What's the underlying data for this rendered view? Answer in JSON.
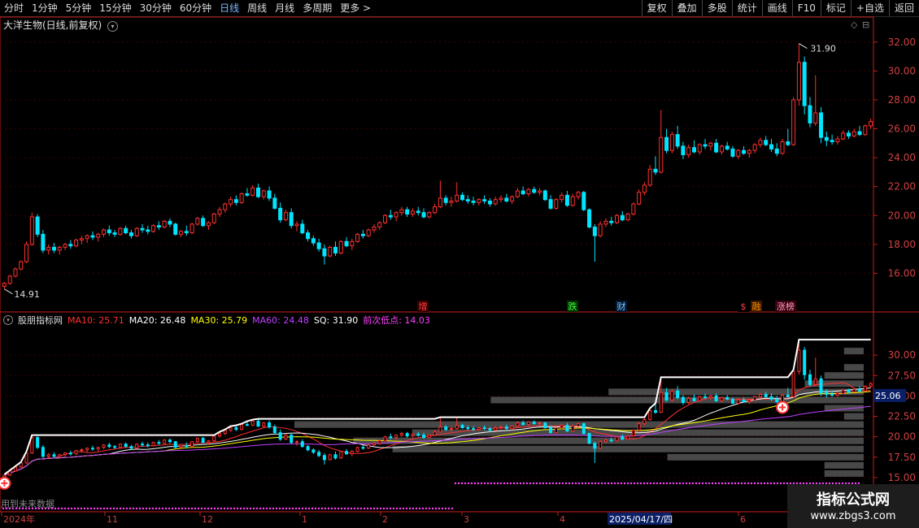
{
  "toolbar": {
    "periods": [
      "分时",
      "1分钟",
      "5分钟",
      "15分钟",
      "30分钟",
      "60分钟",
      "日线",
      "周线",
      "月线",
      "多周期",
      "更多 >"
    ],
    "active_period": "日线",
    "tools": [
      "复权",
      "叠加",
      "多股",
      "统计",
      "画线",
      "F10",
      "标记",
      "+自选",
      "返回"
    ]
  },
  "main_pane": {
    "title": "大洋生物(日线,前复权)",
    "high_label": "31.90",
    "low_label": "14.91",
    "events": [
      {
        "label": "增",
        "color": "#ff4040",
        "bg": "#3a0000"
      },
      {
        "label": "跌",
        "color": "#40ff40",
        "bg": "#003300"
      },
      {
        "label": "财",
        "color": "#7fbfff",
        "bg": "#001a33"
      },
      {
        "label": "$",
        "color": "#ff4040",
        "bg": "#000"
      },
      {
        "label": "融",
        "color": "#ff8c00",
        "bg": "#3a1a00"
      },
      {
        "label": "涨榜",
        "color": "#ff9ebb",
        "bg": "#3a0010"
      }
    ],
    "price_axis": [
      "32.00",
      "30.00",
      "28.00",
      "26.00",
      "24.00",
      "22.00",
      "20.00",
      "18.00",
      "16.00"
    ]
  },
  "indicator_pane": {
    "name": "股朋指标网",
    "legend": [
      {
        "label": "MA10: 25.71",
        "color": "#ff3030"
      },
      {
        "label": "MA20: 26.48",
        "color": "#ffffff"
      },
      {
        "label": "MA30: 25.79",
        "color": "#ffff00"
      },
      {
        "label": "MA60: 24.48",
        "color": "#c040ff"
      },
      {
        "label": "SQ: 31.90",
        "color": "#ffffff"
      },
      {
        "label": "前次低点: 14.03",
        "color": "#ff40ff"
      }
    ],
    "price_axis": [
      "30.00",
      "27.50",
      "25.00",
      "22.50",
      "20.00",
      "17.50",
      "15.00"
    ],
    "current_value": "25.06",
    "footer_note": "用到未来数据"
  },
  "time_axis": {
    "labels": [
      "2024年",
      "11",
      "12",
      "1",
      "2",
      "3",
      "4",
      "2025/04/17/四",
      "6"
    ],
    "cursor_date": "2025/04/17/四"
  },
  "watermark": {
    "line1": "指标公式网",
    "line2": "www.zbgs3.com"
  },
  "colors": {
    "up": "#ff3030",
    "down": "#00e5ff",
    "grid_red": "#8b0000",
    "axis_red": "#c81e1e"
  },
  "chart_data": {
    "type": "candlestick",
    "note_units": "CNY",
    "price_range_main": [
      14.0,
      33.0
    ],
    "price_range_indicator": [
      14.0,
      33.5
    ],
    "start_index_label": "2024年",
    "ohlc": [
      [
        15.1,
        15.4,
        14.91,
        15.3
      ],
      [
        15.3,
        15.9,
        15.2,
        15.8
      ],
      [
        15.8,
        16.4,
        15.7,
        16.3
      ],
      [
        16.3,
        16.9,
        16.2,
        16.8
      ],
      [
        16.8,
        18.2,
        16.7,
        18.0
      ],
      [
        18.0,
        20.2,
        17.9,
        19.9
      ],
      [
        19.9,
        20.1,
        18.5,
        18.7
      ],
      [
        18.7,
        19.0,
        17.4,
        17.6
      ],
      [
        17.6,
        18.0,
        17.3,
        17.8
      ],
      [
        17.8,
        18.1,
        17.4,
        17.6
      ],
      [
        17.6,
        17.9,
        17.3,
        17.8
      ],
      [
        17.8,
        18.1,
        17.6,
        18.0
      ],
      [
        18.0,
        18.3,
        17.7,
        17.9
      ],
      [
        17.9,
        18.4,
        17.8,
        18.3
      ],
      [
        18.3,
        18.6,
        18.0,
        18.4
      ],
      [
        18.4,
        18.7,
        18.1,
        18.6
      ],
      [
        18.6,
        18.9,
        18.3,
        18.5
      ],
      [
        18.5,
        18.8,
        18.2,
        18.7
      ],
      [
        18.7,
        19.1,
        18.5,
        19.0
      ],
      [
        19.0,
        19.3,
        18.6,
        18.8
      ],
      [
        18.8,
        19.0,
        18.5,
        18.7
      ],
      [
        18.7,
        19.2,
        18.6,
        19.1
      ],
      [
        19.1,
        19.3,
        18.7,
        18.8
      ],
      [
        18.8,
        19.0,
        18.4,
        18.6
      ],
      [
        18.6,
        19.2,
        18.5,
        19.1
      ],
      [
        19.1,
        19.4,
        18.8,
        19.0
      ],
      [
        19.0,
        19.3,
        18.7,
        18.9
      ],
      [
        18.9,
        19.4,
        18.8,
        19.3
      ],
      [
        19.3,
        19.6,
        19.0,
        19.2
      ],
      [
        19.2,
        19.7,
        19.1,
        19.6
      ],
      [
        19.6,
        19.8,
        19.2,
        19.4
      ],
      [
        19.4,
        19.5,
        18.6,
        18.7
      ],
      [
        18.7,
        19.0,
        18.5,
        18.9
      ],
      [
        18.9,
        19.3,
        18.6,
        18.8
      ],
      [
        18.8,
        19.5,
        18.7,
        19.4
      ],
      [
        19.4,
        19.9,
        19.3,
        19.8
      ],
      [
        19.8,
        20.0,
        19.2,
        19.3
      ],
      [
        19.3,
        19.6,
        19.0,
        19.5
      ],
      [
        19.5,
        20.2,
        19.4,
        20.1
      ],
      [
        20.1,
        20.6,
        19.9,
        20.4
      ],
      [
        20.4,
        20.9,
        20.2,
        20.8
      ],
      [
        20.8,
        21.3,
        20.6,
        21.1
      ],
      [
        21.1,
        21.4,
        20.7,
        20.9
      ],
      [
        20.9,
        21.6,
        20.8,
        21.5
      ],
      [
        21.5,
        21.9,
        21.3,
        21.4
      ],
      [
        21.4,
        22.1,
        21.3,
        21.9
      ],
      [
        21.9,
        22.2,
        21.2,
        21.3
      ],
      [
        21.3,
        21.8,
        21.1,
        21.7
      ],
      [
        21.7,
        22.0,
        21.0,
        21.2
      ],
      [
        21.2,
        21.5,
        20.4,
        20.5
      ],
      [
        20.5,
        20.9,
        19.5,
        19.7
      ],
      [
        19.7,
        20.4,
        19.6,
        20.2
      ],
      [
        20.2,
        20.5,
        19.1,
        19.3
      ],
      [
        19.3,
        19.6,
        18.9,
        19.4
      ],
      [
        19.4,
        19.7,
        18.7,
        18.8
      ],
      [
        18.8,
        19.0,
        18.2,
        18.4
      ],
      [
        18.4,
        18.6,
        17.9,
        18.1
      ],
      [
        18.1,
        18.4,
        17.5,
        17.7
      ],
      [
        17.7,
        18.0,
        16.6,
        17.2
      ],
      [
        17.2,
        17.9,
        17.1,
        17.8
      ],
      [
        17.8,
        18.2,
        17.2,
        17.4
      ],
      [
        17.4,
        18.3,
        17.3,
        18.2
      ],
      [
        18.2,
        18.5,
        17.8,
        17.9
      ],
      [
        17.9,
        18.4,
        17.6,
        18.2
      ],
      [
        18.2,
        18.8,
        18.1,
        18.7
      ],
      [
        18.7,
        19.0,
        18.4,
        18.6
      ],
      [
        18.6,
        19.1,
        18.5,
        19.0
      ],
      [
        19.0,
        19.4,
        18.8,
        19.2
      ],
      [
        19.2,
        19.6,
        19.0,
        19.5
      ],
      [
        19.5,
        20.1,
        19.4,
        20.0
      ],
      [
        20.0,
        20.4,
        19.7,
        19.9
      ],
      [
        19.9,
        20.3,
        19.6,
        20.2
      ],
      [
        20.2,
        20.6,
        20.0,
        20.4
      ],
      [
        20.4,
        20.6,
        19.9,
        20.1
      ],
      [
        20.1,
        20.5,
        19.9,
        20.3
      ],
      [
        20.3,
        20.6,
        20.0,
        20.2
      ],
      [
        20.2,
        20.5,
        19.8,
        19.9
      ],
      [
        19.9,
        20.3,
        19.8,
        20.2
      ],
      [
        20.2,
        20.8,
        20.1,
        20.6
      ],
      [
        20.6,
        22.4,
        20.5,
        21.2
      ],
      [
        21.2,
        21.4,
        20.7,
        20.9
      ],
      [
        20.9,
        21.3,
        20.6,
        21.0
      ],
      [
        21.0,
        22.3,
        20.9,
        21.4
      ],
      [
        21.4,
        21.6,
        21.0,
        21.1
      ],
      [
        21.1,
        21.4,
        20.8,
        21.0
      ],
      [
        21.0,
        21.3,
        20.7,
        20.9
      ],
      [
        20.9,
        21.2,
        20.7,
        21.1
      ],
      [
        21.1,
        21.4,
        20.8,
        21.0
      ],
      [
        21.0,
        21.2,
        20.6,
        20.8
      ],
      [
        20.8,
        21.3,
        20.7,
        21.1
      ],
      [
        21.1,
        21.4,
        20.9,
        21.2
      ],
      [
        21.2,
        21.5,
        20.9,
        21.0
      ],
      [
        21.0,
        21.4,
        20.8,
        21.3
      ],
      [
        21.3,
        21.9,
        21.2,
        21.7
      ],
      [
        21.7,
        22.0,
        21.4,
        21.5
      ],
      [
        21.5,
        21.9,
        21.3,
        21.8
      ],
      [
        21.8,
        22.0,
        21.5,
        21.6
      ],
      [
        21.6,
        21.9,
        21.4,
        21.7
      ],
      [
        21.7,
        21.8,
        21.0,
        21.1
      ],
      [
        21.1,
        21.4,
        20.4,
        20.5
      ],
      [
        20.5,
        21.2,
        20.4,
        21.1
      ],
      [
        21.1,
        21.6,
        20.9,
        21.4
      ],
      [
        21.4,
        21.7,
        20.6,
        20.7
      ],
      [
        20.7,
        21.5,
        20.6,
        21.3
      ],
      [
        21.3,
        21.7,
        21.1,
        21.6
      ],
      [
        21.6,
        21.7,
        20.3,
        20.4
      ],
      [
        20.4,
        20.5,
        19.1,
        19.2
      ],
      [
        19.2,
        19.4,
        16.8,
        18.6
      ],
      [
        18.6,
        19.6,
        18.5,
        19.4
      ],
      [
        19.4,
        19.8,
        19.2,
        19.6
      ],
      [
        19.6,
        19.9,
        19.3,
        19.5
      ],
      [
        19.5,
        20.1,
        19.4,
        20.0
      ],
      [
        20.0,
        20.3,
        19.6,
        19.7
      ],
      [
        19.7,
        20.2,
        19.6,
        20.1
      ],
      [
        20.1,
        20.9,
        20.0,
        20.8
      ],
      [
        20.8,
        21.8,
        20.7,
        21.6
      ],
      [
        21.6,
        22.3,
        21.4,
        22.1
      ],
      [
        22.1,
        23.5,
        22.0,
        23.2
      ],
      [
        23.2,
        24.1,
        22.8,
        23.0
      ],
      [
        23.0,
        27.3,
        22.9,
        25.4
      ],
      [
        25.4,
        26.0,
        24.3,
        24.5
      ],
      [
        24.5,
        25.8,
        24.3,
        25.6
      ],
      [
        25.6,
        26.2,
        24.6,
        24.8
      ],
      [
        24.8,
        25.1,
        23.9,
        24.2
      ],
      [
        24.2,
        24.9,
        24.0,
        24.7
      ],
      [
        24.7,
        25.2,
        24.3,
        24.4
      ],
      [
        24.4,
        25.0,
        24.2,
        24.9
      ],
      [
        24.9,
        25.3,
        24.6,
        24.8
      ],
      [
        24.8,
        25.1,
        24.5,
        25.0
      ],
      [
        25.0,
        25.3,
        24.3,
        24.4
      ],
      [
        24.4,
        24.9,
        24.2,
        24.8
      ],
      [
        24.8,
        25.1,
        24.5,
        24.6
      ],
      [
        24.6,
        24.8,
        24.0,
        24.1
      ],
      [
        24.1,
        24.6,
        23.9,
        24.5
      ],
      [
        24.5,
        24.8,
        24.2,
        24.3
      ],
      [
        24.3,
        24.6,
        24.0,
        24.5
      ],
      [
        24.5,
        25.0,
        24.3,
        24.9
      ],
      [
        24.9,
        25.4,
        24.7,
        25.2
      ],
      [
        25.2,
        25.5,
        24.8,
        24.9
      ],
      [
        24.9,
        25.3,
        24.4,
        24.6
      ],
      [
        24.6,
        25.0,
        24.1,
        24.3
      ],
      [
        24.3,
        25.3,
        24.2,
        25.1
      ],
      [
        25.1,
        26.0,
        24.8,
        24.9
      ],
      [
        24.9,
        28.2,
        24.8,
        28.0
      ],
      [
        28.0,
        31.9,
        27.6,
        30.6
      ],
      [
        30.6,
        31.0,
        27.0,
        27.6
      ],
      [
        27.6,
        28.2,
        26.1,
        26.4
      ],
      [
        26.4,
        29.7,
        26.2,
        27.1
      ],
      [
        27.1,
        27.5,
        25.0,
        25.4
      ],
      [
        25.4,
        25.8,
        24.8,
        25.2
      ],
      [
        25.2,
        25.6,
        24.9,
        25.1
      ],
      [
        25.1,
        25.5,
        24.9,
        25.3
      ],
      [
        25.3,
        25.9,
        25.2,
        25.7
      ],
      [
        25.7,
        25.9,
        25.3,
        25.5
      ],
      [
        25.5,
        26.0,
        25.4,
        25.8
      ],
      [
        25.8,
        26.2,
        25.5,
        25.6
      ],
      [
        25.6,
        26.3,
        25.5,
        26.2
      ],
      [
        26.2,
        26.7,
        26.0,
        26.5
      ]
    ]
  }
}
